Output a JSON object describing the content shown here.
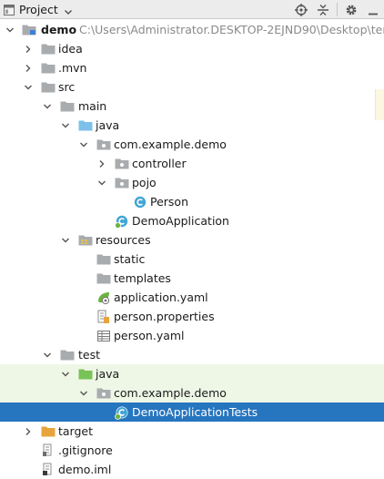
{
  "toolbar": {
    "title": "Project"
  },
  "tree": {
    "root": {
      "label": "demo",
      "path": "C:\\Users\\Administrator.DESKTOP-2EJND90\\Desktop\\tem"
    },
    "idea": "idea",
    "mvn": ".mvn",
    "src": "src",
    "main": "main",
    "java_main": "java",
    "pkg_main": "com.example.demo",
    "controller": "controller",
    "pojo": "pojo",
    "person": "Person",
    "demo_app": "DemoApplication",
    "resources": "resources",
    "static": "static",
    "templates": "templates",
    "application_yaml": "application.yaml",
    "person_properties": "person.properties",
    "person_yaml": "person.yaml",
    "test": "test",
    "java_test": "java",
    "pkg_test": "com.example.demo",
    "demo_tests": "DemoApplicationTests",
    "target": "target",
    "gitignore": ".gitignore",
    "demo_iml": "demo.iml"
  },
  "colors": {
    "folder": "#a9acaf",
    "source_folder": "#7dc0ea",
    "test_folder": "#78c257",
    "target_folder": "#e8a43c",
    "class_icon": "#43a6d8",
    "selection": "#2675bf",
    "test_row_bg": "#eef6e6"
  }
}
